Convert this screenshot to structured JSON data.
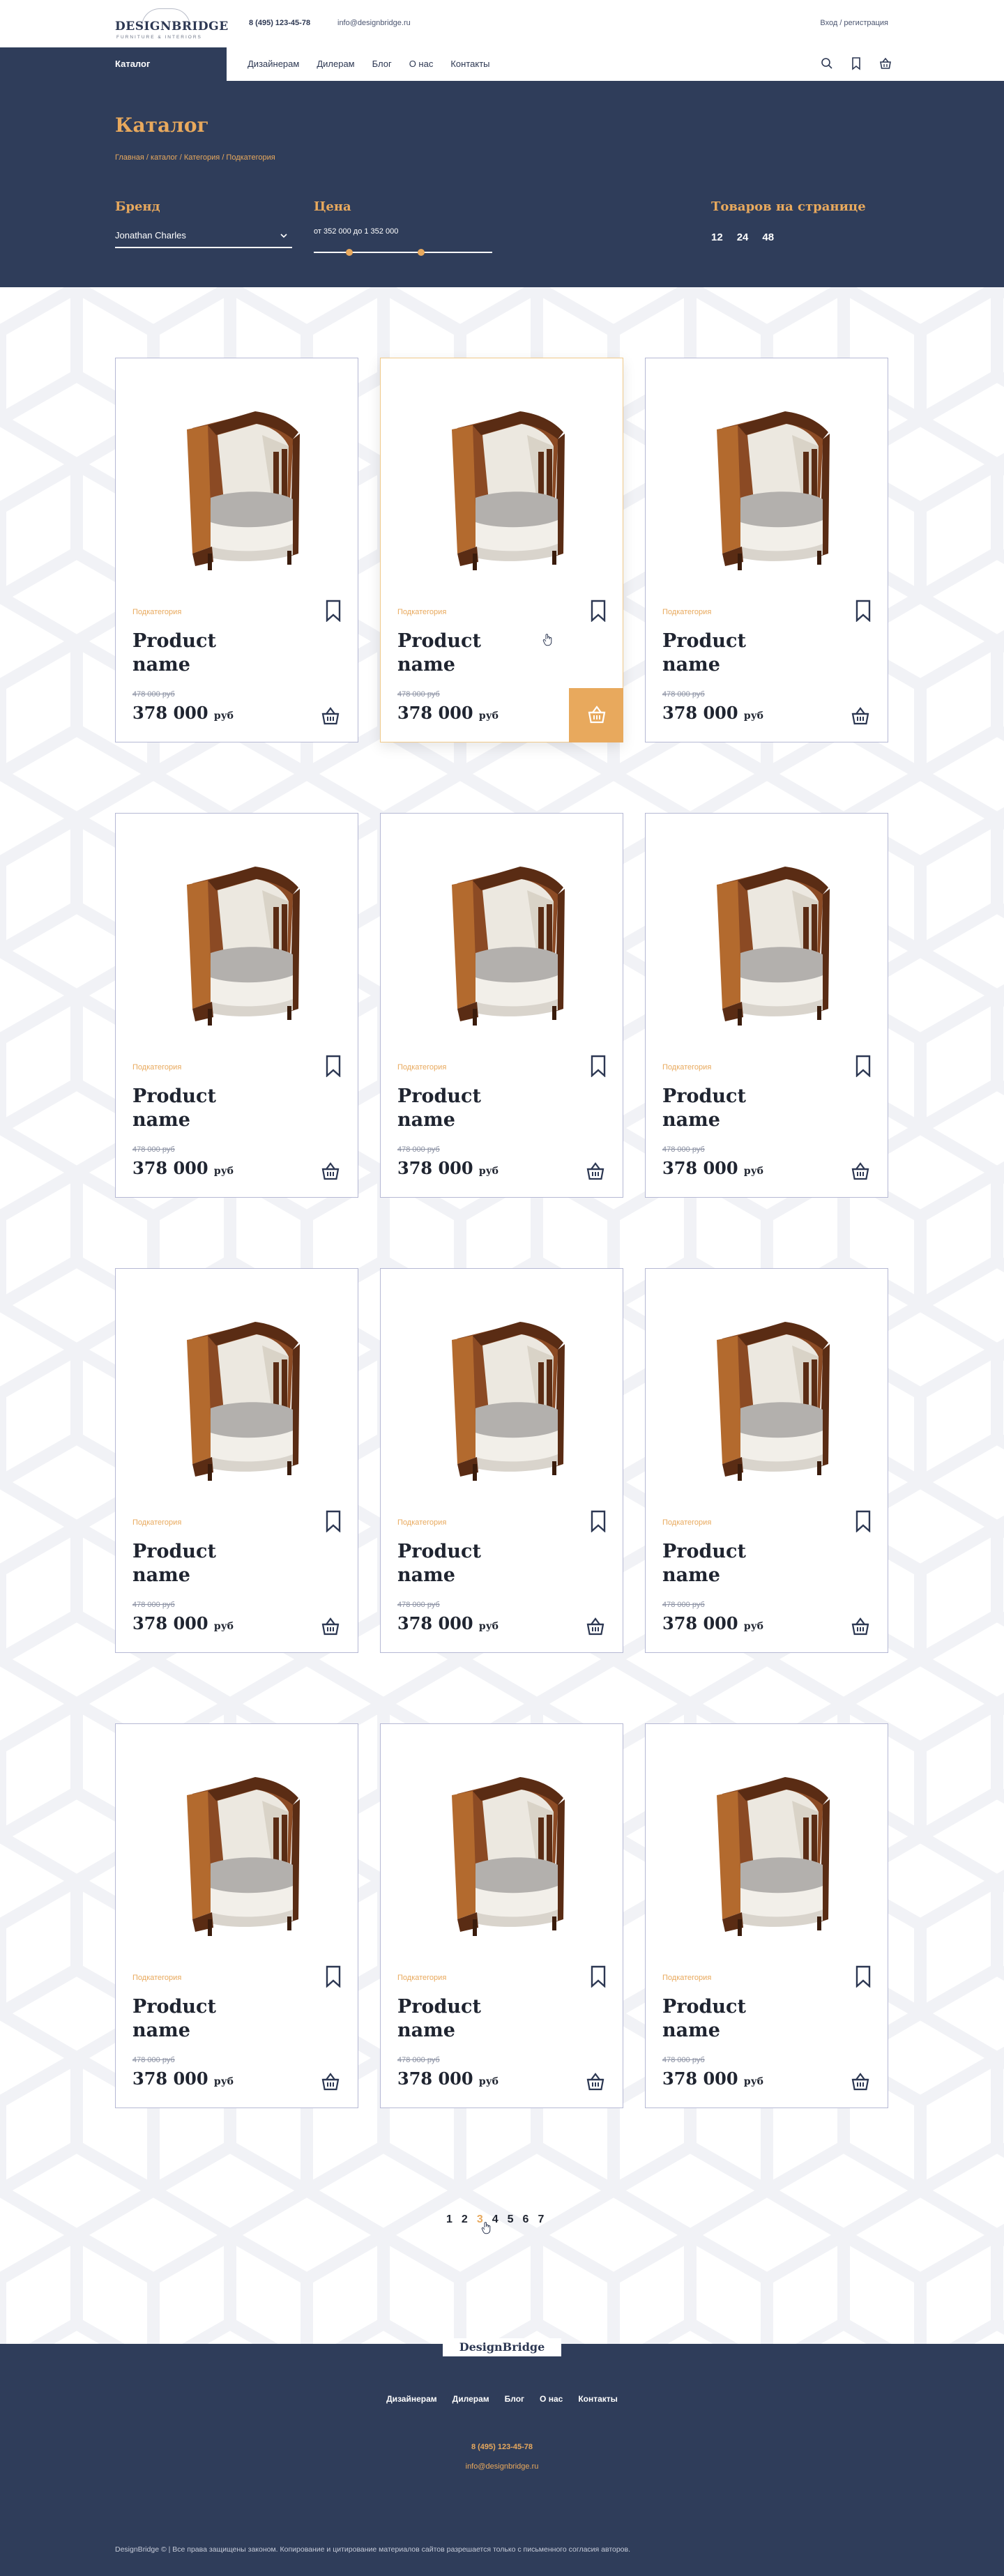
{
  "header": {
    "logo_name": "DESIGNBRIDGE",
    "logo_tagline": "FURNITURE & INTERIORS",
    "phone": "8 (495) 123-45-78",
    "email": "info@designbridge.ru",
    "login": "Вход / регистрация"
  },
  "nav": {
    "catalog": "Каталог",
    "links": [
      "Дизайнерам",
      "Дилерам",
      "Блог",
      "О нас",
      "Контакты"
    ],
    "icons": [
      "search-icon",
      "bookmark-icon",
      "basket-icon"
    ]
  },
  "hero": {
    "title": "Каталог",
    "breadcrumbs": "Главная / каталог / Категория / Подкатегория",
    "brand_label": "Бренд",
    "brand_value": "Jonathan Charles",
    "price_label": "Цена",
    "price_range": "от 352 000   до 1 352 000",
    "slider_range": [
      0.2,
      0.6
    ],
    "per_page_label": "Товаров на странице",
    "per_page_options": [
      "12",
      "24",
      "48"
    ]
  },
  "product": {
    "subcategory": "Подкатегория",
    "name_line1": "Product",
    "name_line2": "name",
    "old_price": "478 000 руб",
    "price": "378 000",
    "currency": "руб"
  },
  "pagination": {
    "pages": [
      "1",
      "2",
      "3",
      "4",
      "5",
      "6",
      "7"
    ],
    "current": "3"
  },
  "footer": {
    "logo": "DesignBridge",
    "links": [
      "Дизайнерам",
      "Дилерам",
      "Блог",
      "О нас",
      "Контакты"
    ],
    "phone": "8 (495) 123-45-78",
    "email": "info@designbridge.ru",
    "copyright": "DesignBridge © | Все права защищены законом. Копирование и цитирование материалов сайтов разрешается только с письменного согласия авторов."
  },
  "colors": {
    "navy": "#2f3d5a",
    "accent": "#e8a95d",
    "card_border": "#b5b8d4"
  }
}
